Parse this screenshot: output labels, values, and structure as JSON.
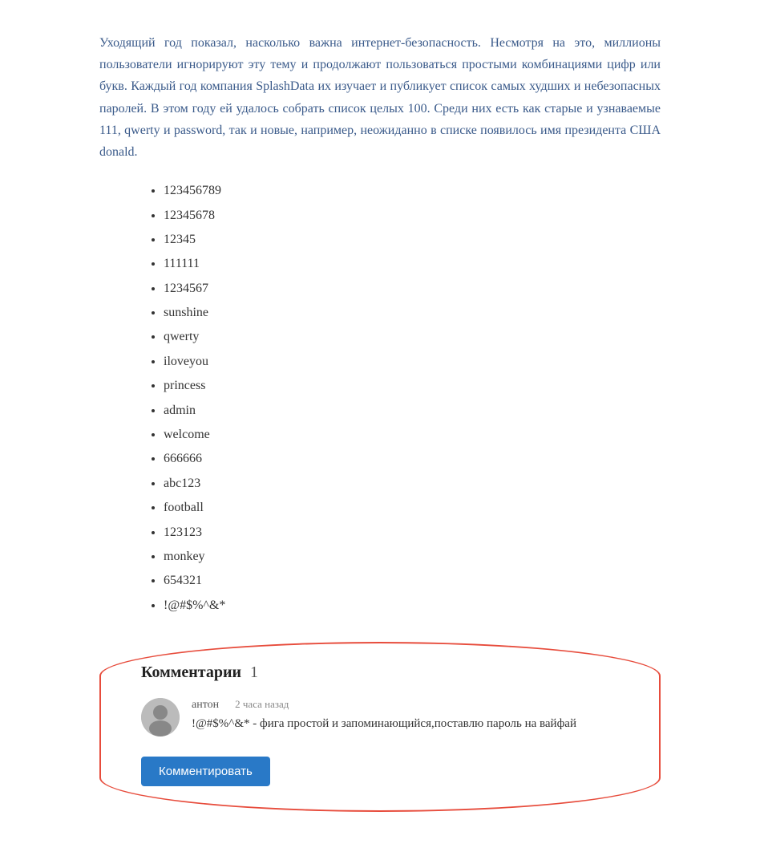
{
  "article": {
    "paragraph": "Уходящий год показал, насколько важна интернет-безопасность. Несмотря на это, миллионы пользователи игнорируют эту тему и продолжают пользоваться простыми комбинациями цифр или букв. Каждый год компания SplashData их изучает и публикует список самых худших и небезопасных паролей. В этом году ей удалось собрать список целых 100. Среди них есть как старые и узнаваемые 111, qwerty и password, так и новые, например, неожиданно в списке появилось имя президента США donald.",
    "passwords": [
      "123456789",
      "12345678",
      "12345",
      "111111",
      "1234567",
      "sunshine",
      "qwerty",
      "iloveyou",
      "princess",
      "admin",
      "welcome",
      "666666",
      "abc123",
      "football",
      "123123",
      "monkey",
      "654321",
      "!@#$%^&*"
    ]
  },
  "comments": {
    "section_title": "Комментарии",
    "count": "1",
    "items": [
      {
        "author": "антон",
        "time": "2 часа назад",
        "text": "!@#$%^&* - фига простой и запоминающийся,поставлю пароль на вайфай"
      }
    ],
    "button_label": "Комментировать"
  }
}
